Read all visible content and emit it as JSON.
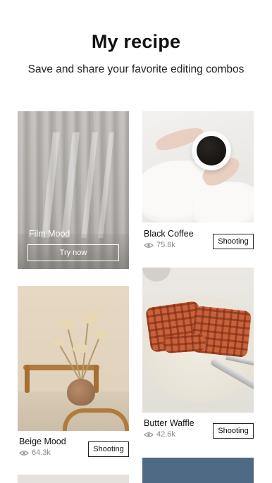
{
  "header": {
    "title": "My recipe",
    "subtitle": "Save and share your favorite editing combos"
  },
  "cards": {
    "film": {
      "title": "Film Mood",
      "button": "Try now"
    },
    "coffee": {
      "title": "Black Coffee",
      "views": "75.8k",
      "button": "Shooting"
    },
    "waffle": {
      "title": "Butter Waffle",
      "views": "42.6k",
      "button": "Shooting"
    },
    "beige": {
      "title": "Beige Mood",
      "views": "64.3k",
      "button": "Shooting"
    }
  },
  "icons": {
    "views": "eye-icon"
  },
  "colors": {
    "text": "#111111",
    "muted": "#888888",
    "button_border": "#222222"
  }
}
